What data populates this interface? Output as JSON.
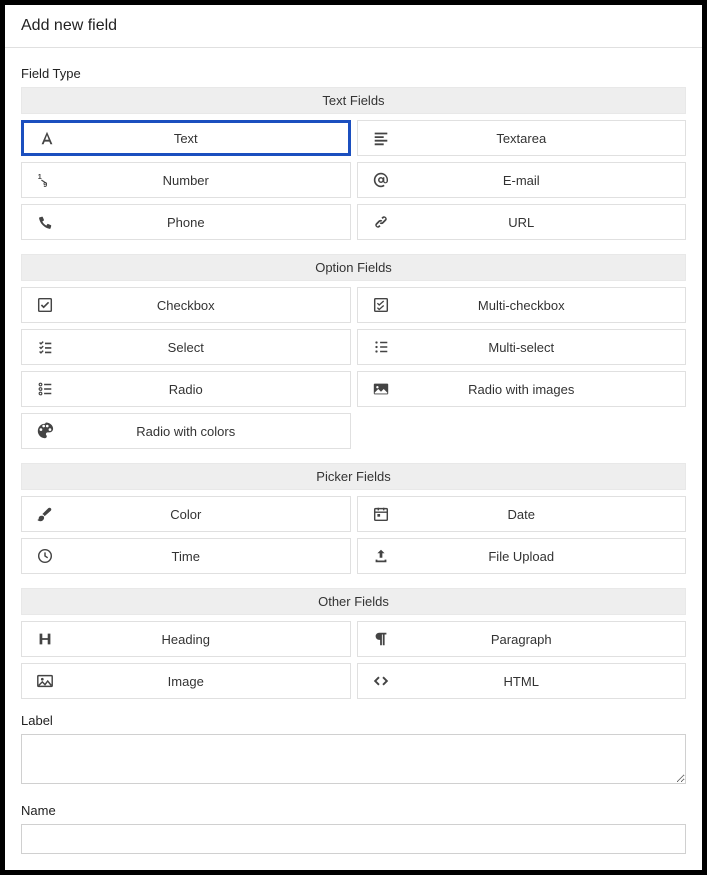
{
  "dialog_title": "Add new field",
  "field_type_label": "Field Type",
  "label_label": "Label",
  "name_label": "Name",
  "label_value": "",
  "name_value": "",
  "selected_field": "text",
  "groups": [
    {
      "header": "Text Fields",
      "items": [
        {
          "id": "text",
          "label": "Text",
          "icon": "font-icon"
        },
        {
          "id": "textarea",
          "label": "Textarea",
          "icon": "align-left-icon"
        },
        {
          "id": "number",
          "label": "Number",
          "icon": "number-icon"
        },
        {
          "id": "email",
          "label": "E-mail",
          "icon": "at-icon"
        },
        {
          "id": "phone",
          "label": "Phone",
          "icon": "phone-icon"
        },
        {
          "id": "url",
          "label": "URL",
          "icon": "link-icon"
        }
      ]
    },
    {
      "header": "Option Fields",
      "items": [
        {
          "id": "checkbox",
          "label": "Checkbox",
          "icon": "checkbox-icon"
        },
        {
          "id": "multi-checkbox",
          "label": "Multi-checkbox",
          "icon": "multi-checkbox-icon"
        },
        {
          "id": "select",
          "label": "Select",
          "icon": "list-check-icon"
        },
        {
          "id": "multi-select",
          "label": "Multi-select",
          "icon": "multi-list-icon"
        },
        {
          "id": "radio",
          "label": "Radio",
          "icon": "radio-list-icon"
        },
        {
          "id": "radio-images",
          "label": "Radio with images",
          "icon": "image-radio-icon"
        },
        {
          "id": "radio-colors",
          "label": "Radio with colors",
          "icon": "palette-icon"
        }
      ]
    },
    {
      "header": "Picker Fields",
      "items": [
        {
          "id": "color",
          "label": "Color",
          "icon": "brush-icon"
        },
        {
          "id": "date",
          "label": "Date",
          "icon": "calendar-icon"
        },
        {
          "id": "time",
          "label": "Time",
          "icon": "clock-icon"
        },
        {
          "id": "upload",
          "label": "File Upload",
          "icon": "upload-icon"
        }
      ]
    },
    {
      "header": "Other Fields",
      "items": [
        {
          "id": "heading",
          "label": "Heading",
          "icon": "heading-icon"
        },
        {
          "id": "paragraph",
          "label": "Paragraph",
          "icon": "paragraph-icon"
        },
        {
          "id": "image",
          "label": "Image",
          "icon": "image-icon"
        },
        {
          "id": "html",
          "label": "HTML",
          "icon": "code-icon"
        }
      ]
    }
  ]
}
